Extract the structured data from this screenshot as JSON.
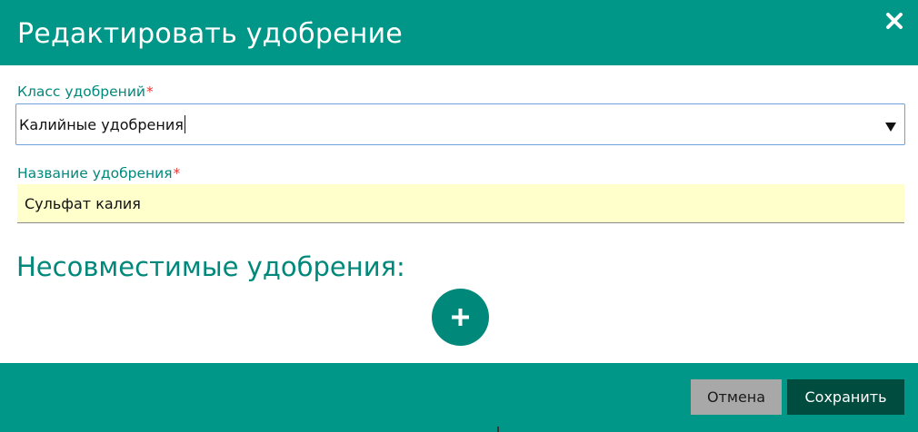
{
  "dialog": {
    "title": "Редактировать удобрение",
    "close_icon": "close-icon"
  },
  "form": {
    "class_field": {
      "label": "Класс удобрений",
      "required_mark": "*",
      "value": "Калийные удобрения",
      "arrow_icon": "dropdown-arrow-icon"
    },
    "name_field": {
      "label": "Название удобрения",
      "required_mark": "*",
      "value": "Сульфат калия"
    },
    "incompatible": {
      "title": "Несовместимые удобрения:",
      "add_icon": "plus-icon"
    }
  },
  "footer": {
    "cancel_label": "Отмена",
    "save_label": "Сохранить"
  },
  "colors": {
    "header": "#009688",
    "accent_text": "#00897b",
    "required": "#e53935",
    "input_highlight": "#ffffcc",
    "save_button": "#004d40",
    "cancel_button": "#a8a8a8"
  }
}
